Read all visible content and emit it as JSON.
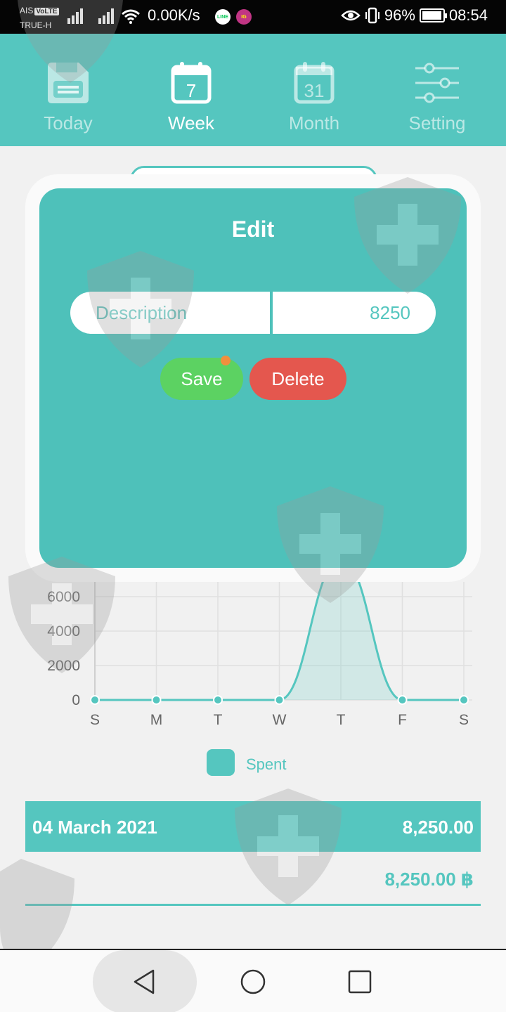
{
  "status_bar": {
    "carrier": "AIS",
    "volte": "VoLTE",
    "carrier2": "TRUE-H",
    "net_speed": "0.00K/s",
    "app1": "LINE",
    "app2": "IG",
    "battery": "96%",
    "battery_level": 0.96,
    "time": "08:54"
  },
  "nav": {
    "items": [
      {
        "label": "Today",
        "icon": "save-disk-icon"
      },
      {
        "label": "Week",
        "icon": "calendar-7-icon",
        "day": "7"
      },
      {
        "label": "Month",
        "icon": "calendar-31-icon",
        "day": "31"
      },
      {
        "label": "Setting",
        "icon": "sliders-icon"
      }
    ],
    "active": "Week"
  },
  "dialog": {
    "title": "Edit",
    "description_placeholder": "Description",
    "amount_value": "8250",
    "save_label": "Save",
    "delete_label": "Delete"
  },
  "chart_data": {
    "type": "area",
    "categories": [
      "S",
      "M",
      "T",
      "W",
      "T",
      "F",
      "S"
    ],
    "series": [
      {
        "name": "Spent",
        "values": [
          0,
          0,
          0,
          0,
          8250,
          0,
          0
        ]
      }
    ],
    "yticks": [
      "0",
      "2000",
      "4000",
      "6000"
    ],
    "ylim": [
      0,
      8250
    ],
    "grid": true,
    "legend": "bottom",
    "color": "#55c6bf"
  },
  "summary": {
    "date": "04 March 2021",
    "amount": "8,250.00",
    "total": "8,250.00 ฿"
  }
}
